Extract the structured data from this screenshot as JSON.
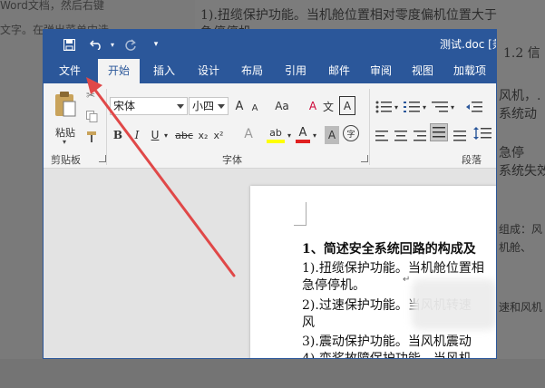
{
  "background": {
    "top_left_line1": "Word文档，然后右键",
    "top_left_line2": "文字。在弹出菜单中选",
    "top_line": "1).扭缆保护功能。当机舱位置相对零度偏机位置大于",
    "top_line2": "急停停机",
    "top_right_num": "1.2 信",
    "right_lines": [
      "风机，.",
      "系统动",
      "急停",
      "系统失效"
    ],
    "right_under": [
      "组成：风",
      "机舱、",
      "速和风机"
    ]
  },
  "window": {
    "title": "测试.doc [兼",
    "qat": {
      "save_icon": "save-icon",
      "undo_icon": "undo-icon",
      "redo_icon": "redo-icon",
      "customize_icon": "customize-icon"
    },
    "tabs": [
      {
        "label": "文件"
      },
      {
        "label": "开始",
        "active": true
      },
      {
        "label": "插入"
      },
      {
        "label": "设计"
      },
      {
        "label": "布局"
      },
      {
        "label": "引用"
      },
      {
        "label": "邮件"
      },
      {
        "label": "审阅"
      },
      {
        "label": "视图"
      },
      {
        "label": "加载项"
      }
    ]
  },
  "ribbon": {
    "clipboard": {
      "paste_label": "粘贴",
      "group_label": "剪贴板"
    },
    "font": {
      "font_name": "宋体",
      "font_size": "小四",
      "grow": "A",
      "shrink": "A",
      "change_case": "Aa",
      "clear_format": "A",
      "pinyin": "文",
      "border_char": "A",
      "bold": "B",
      "italic": "I",
      "underline": "U",
      "strike": "abc",
      "subscript": "x₂",
      "superscript": "x²",
      "text_effect": "A",
      "highlight": "ab",
      "font_color": "A",
      "char_shading": "A",
      "enclose_char": "字",
      "group_label": "字体"
    },
    "paragraph": {
      "group_label": "段落"
    }
  },
  "document": {
    "heading": "1、简述安全系统回路的构成及",
    "lines": [
      "1).扭缆保护功能。当机舱位置相",
      "急停停机。",
      "2).过速保护功能。当风机转速",
      "风",
      "3).震动保护功能。当风机震动",
      "4).变桨故障保护功能。当风机"
    ],
    "paragraph_mark": "↵"
  },
  "colors": {
    "accent": "#2b579a",
    "arrow": "#e04848",
    "highlight_yellow": "#ffff00",
    "font_red": "#e02020"
  }
}
